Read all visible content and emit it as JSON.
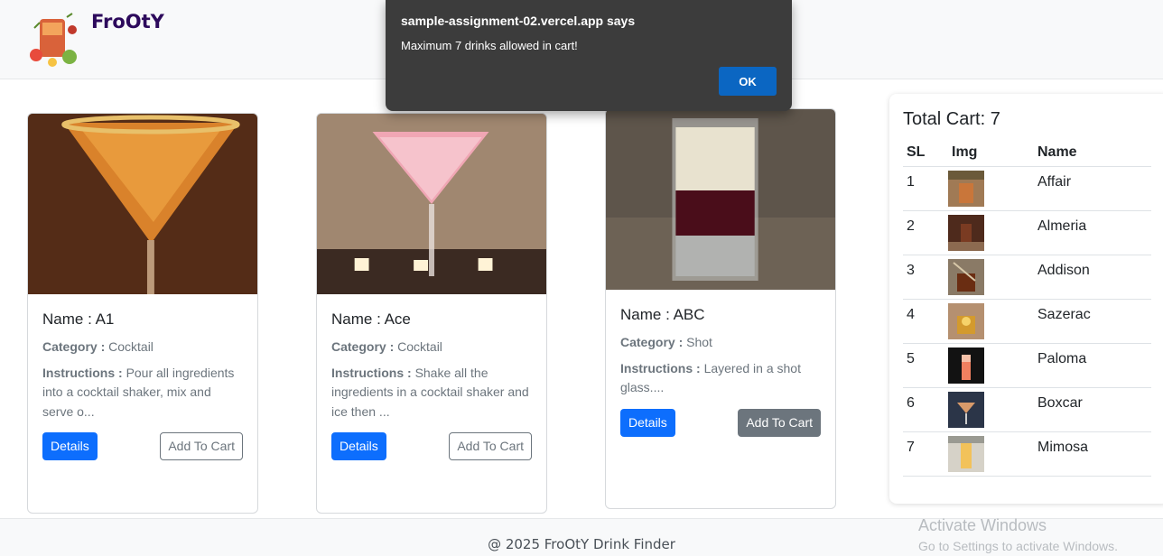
{
  "navbar": {
    "brand": "FroOtY"
  },
  "cards": [
    {
      "name": "Name : A1",
      "category_label": "Category :",
      "category": "Cocktail",
      "instructions_label": "Instructions :",
      "instructions": "Pour all ingredients into a cocktail shaker, mix and serve o...",
      "details_label": "Details",
      "add_label": "Add To Cart"
    },
    {
      "name": "Name : Ace",
      "category_label": "Category :",
      "category": "Cocktail",
      "instructions_label": "Instructions :",
      "instructions": "Shake all the ingredients in a cocktail shaker and ice then ...",
      "details_label": "Details",
      "add_label": "Add To Cart"
    },
    {
      "name": "Name : ABC",
      "category_label": "Category :",
      "category": "Shot",
      "instructions_label": "Instructions :",
      "instructions": "Layered in a shot glass....",
      "details_label": "Details",
      "add_label": "Add To Cart"
    }
  ],
  "cart": {
    "title": "Total Cart: 7",
    "headers": [
      "SL",
      "Img",
      "Name"
    ],
    "rows": [
      {
        "sl": "1",
        "name": "Affair"
      },
      {
        "sl": "2",
        "name": "Almeria"
      },
      {
        "sl": "3",
        "name": "Addison"
      },
      {
        "sl": "4",
        "name": "Sazerac"
      },
      {
        "sl": "5",
        "name": "Paloma"
      },
      {
        "sl": "6",
        "name": "Boxcar"
      },
      {
        "sl": "7",
        "name": "Mimosa"
      }
    ]
  },
  "footer": {
    "text": "@ 2025 FroOtY Drink Finder"
  },
  "watermark": {
    "line1": "Activate Windows",
    "line2": "Go to Settings to activate Windows."
  },
  "dialog": {
    "title": "sample-assignment-02.vercel.app says",
    "message": "Maximum 7 drinks allowed in cart!",
    "ok_label": "OK"
  },
  "colors": {
    "primary": "#0d6efd",
    "secondary": "#6c757d",
    "dialog_bg": "#3c3c3c",
    "dialog_button": "#0b66c2",
    "brand": "#2d0a5c"
  }
}
